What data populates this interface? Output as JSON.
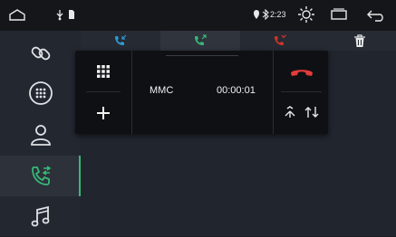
{
  "status_bar": {
    "icons": [
      "home-outline-icon",
      "usb-icon",
      "sd-card-icon",
      "location-icon",
      "bluetooth-icon",
      "brightness-icon",
      "recent-apps-icon",
      "back-icon"
    ],
    "time": "2:23"
  },
  "sidebar": {
    "items": [
      {
        "name": "link-icon",
        "active": false
      },
      {
        "name": "dialpad-icon",
        "active": false
      },
      {
        "name": "contacts-icon",
        "active": false
      },
      {
        "name": "call-log-icon",
        "active": true
      },
      {
        "name": "music-icon",
        "active": false
      }
    ],
    "accent": "#37b977"
  },
  "call_tabs": [
    {
      "name": "incoming-calls-tab",
      "icon": "incoming-call-icon",
      "color": "#2e9bd6"
    },
    {
      "name": "outgoing-calls-tab",
      "icon": "outgoing-call-icon",
      "color": "#37b977",
      "selected": true
    },
    {
      "name": "missed-calls-tab",
      "icon": "missed-call-icon",
      "color": "#d0342c"
    }
  ],
  "call_panel": {
    "caller_name": "MMC",
    "duration": "00:00:01",
    "buttons": [
      "keypad-icon",
      "add-call-icon",
      "hang-up-icon",
      "merge-icon",
      "swap-icon"
    ],
    "hangup_color": "#e33b3b"
  }
}
